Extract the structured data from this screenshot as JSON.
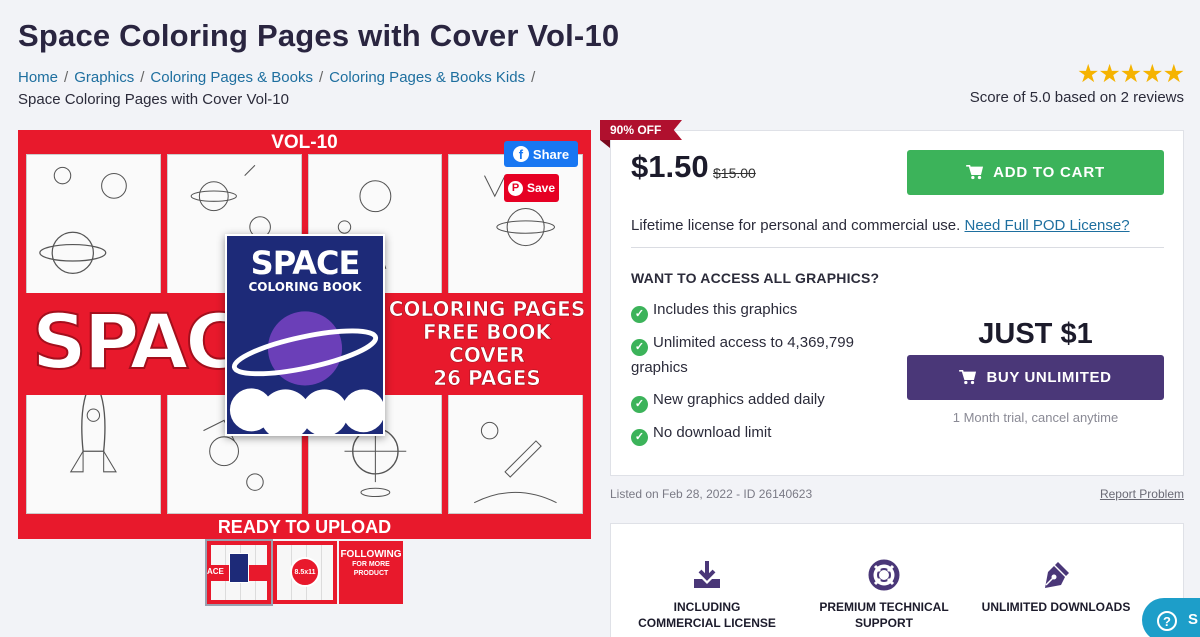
{
  "product": {
    "title": "Space Coloring Pages with Cover Vol-10"
  },
  "breadcrumb": {
    "items": [
      "Home",
      "Graphics",
      "Coloring Pages & Books",
      "Coloring Pages & Books Kids"
    ],
    "current": "Space Coloring Pages with Cover Vol-10"
  },
  "rating": {
    "stars": 5,
    "stars_text": "★★★★★",
    "score_text": "Score of 5.0 based on 2 reviews"
  },
  "image": {
    "vol_text": "VOL-10",
    "space_word": "SPACE",
    "book_title": "SPACE",
    "book_subtitle": "COLORING BOOK",
    "banner_lines": [
      "COLORING PAGES",
      "FREE BOOK COVER",
      "26 PAGES"
    ],
    "footer_text": "READY TO UPLOAD",
    "share_label": "Share",
    "save_label": "Save"
  },
  "thumbnails": [
    {
      "text": "ACE"
    },
    {
      "text": "8.5x11"
    },
    {
      "text": "FOLLOWING",
      "sub": "FOR MORE PRODUCT"
    }
  ],
  "purchase": {
    "discount_badge": "90% OFF",
    "price": "$1.50",
    "old_price": "$15.00",
    "add_to_cart_label": "ADD TO CART",
    "license_text": "Lifetime license for personal and commercial use.",
    "license_link": "Need Full POD License?",
    "unlimited_heading": "WANT TO ACCESS ALL GRAPHICS?",
    "features": [
      "Includes this graphics",
      "Unlimited access to 4,369,799 graphics",
      "New graphics added daily",
      "No download limit"
    ],
    "just_label": "JUST $1",
    "buy_unlimited_label": "BUY UNLIMITED",
    "trial_text": "1 Month trial, cancel anytime"
  },
  "meta": {
    "listed_text": "Listed on Feb 28, 2022 - ID 26140623",
    "report_label": "Report Problem"
  },
  "benefits": [
    {
      "label": "INCLUDING COMMERCIAL LICENSE",
      "icon": "download-icon"
    },
    {
      "label": "PREMIUM TECHNICAL SUPPORT",
      "icon": "lifebuoy-icon"
    },
    {
      "label": "UNLIMITED DOWNLOADS",
      "icon": "pen-nib-icon"
    }
  ],
  "help_widget": {
    "label": "S"
  },
  "colors": {
    "accent_green": "#3cb35a",
    "accent_purple": "#4a3778",
    "badge_red": "#b0102e",
    "link_blue": "#1e6f9f"
  }
}
